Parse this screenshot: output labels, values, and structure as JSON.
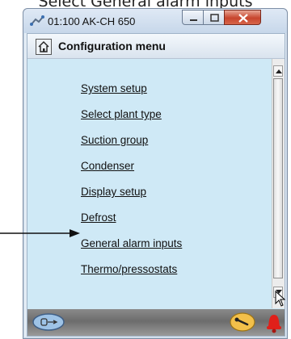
{
  "caption": "Select General alarm inputs",
  "window": {
    "title": "01:100 AK-CH 650",
    "icon": "network-icon"
  },
  "header": {
    "title": "Configuration menu",
    "icon": "home-icon"
  },
  "menu": {
    "items": [
      "System setup",
      "Select plant type",
      "Suction group",
      "Condenser",
      "Display setup",
      "Defrost",
      "General alarm inputs",
      "Thermo/pressostats"
    ],
    "highlighted": "General alarm inputs"
  },
  "bottombar": {
    "left_icon": "overview-icon",
    "right_icon": "wrench-icon",
    "alarm_icon": "alarm-bell-icon"
  },
  "colors": {
    "client_bg": "#cfe9f6",
    "bottombar": "#7a7a7a",
    "close_button": "#c7452d",
    "alarm": "#e0201a"
  }
}
